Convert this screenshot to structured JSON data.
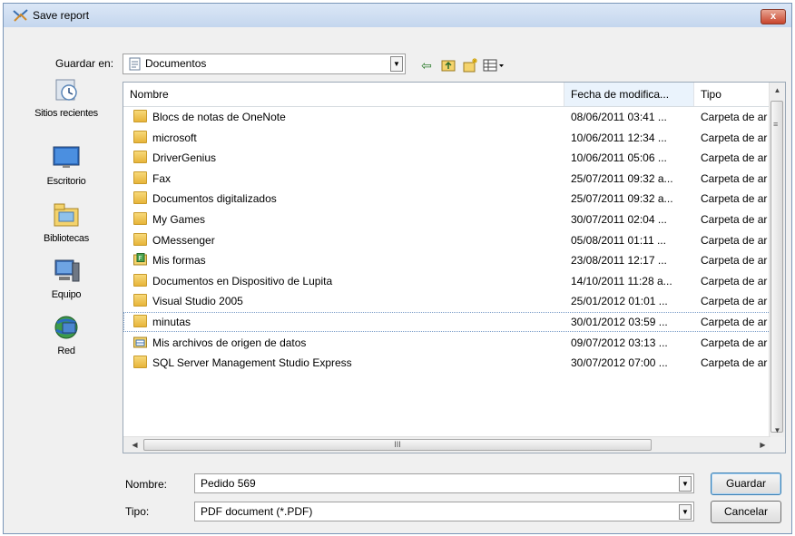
{
  "window": {
    "title": "Save report",
    "close_label": "x"
  },
  "toolbar": {
    "location_label": "Guardar en:",
    "location_value": "Documentos",
    "icons": [
      "back-arrow-icon",
      "up-folder-icon",
      "new-folder-icon",
      "view-menu-icon"
    ]
  },
  "places": [
    {
      "label": "Sitios recientes",
      "icon": "recent-places-icon"
    },
    {
      "label": "Escritorio",
      "icon": "desktop-icon"
    },
    {
      "label": "Bibliotecas",
      "icon": "libraries-icon"
    },
    {
      "label": "Equipo",
      "icon": "computer-icon"
    },
    {
      "label": "Red",
      "icon": "network-icon"
    }
  ],
  "columns": {
    "name": "Nombre",
    "date": "Fecha de modifica...",
    "type": "Tipo"
  },
  "files": [
    {
      "name": "Blocs de notas de OneNote",
      "date": "08/06/2011 03:41 ...",
      "type": "Carpeta de ar",
      "icon": "folder"
    },
    {
      "name": "microsoft",
      "date": "10/06/2011 12:34 ...",
      "type": "Carpeta de ar",
      "icon": "folder"
    },
    {
      "name": "DriverGenius",
      "date": "10/06/2011 05:06 ...",
      "type": "Carpeta de ar",
      "icon": "folder"
    },
    {
      "name": "Fax",
      "date": "25/07/2011 09:32 a...",
      "type": "Carpeta de ar",
      "icon": "folder"
    },
    {
      "name": "Documentos digitalizados",
      "date": "25/07/2011 09:32 a...",
      "type": "Carpeta de ar",
      "icon": "folder"
    },
    {
      "name": "My Games",
      "date": "30/07/2011 02:04 ...",
      "type": "Carpeta de ar",
      "icon": "folder"
    },
    {
      "name": "OMessenger",
      "date": "05/08/2011 01:11 ...",
      "type": "Carpeta de ar",
      "icon": "folder"
    },
    {
      "name": "Mis formas",
      "date": "23/08/2011 12:17 ...",
      "type": "Carpeta de ar",
      "icon": "forms"
    },
    {
      "name": "Documentos en Dispositivo de Lupita",
      "date": "14/10/2011 11:28 a...",
      "type": "Carpeta de ar",
      "icon": "folder"
    },
    {
      "name": "Visual Studio 2005",
      "date": "25/01/2012 01:01 ...",
      "type": "Carpeta de ar",
      "icon": "folder"
    },
    {
      "name": "minutas",
      "date": "30/01/2012 03:59 ...",
      "type": "Carpeta de ar",
      "icon": "folder"
    },
    {
      "name": "Mis archivos de origen de datos",
      "date": "09/07/2012 03:13 ...",
      "type": "Carpeta de ar",
      "icon": "datasource"
    },
    {
      "name": "SQL Server Management Studio Express",
      "date": "30/07/2012 07:00 ...",
      "type": "Carpeta de ar",
      "icon": "folder"
    }
  ],
  "hover_row": 10,
  "scroll": {
    "h_thumb_label": "III",
    "v_marker": "≡"
  },
  "form": {
    "name_label": "Nombre:",
    "name_value": "Pedido 569",
    "type_label": "Tipo:",
    "type_value": "PDF document (*.PDF)"
  },
  "buttons": {
    "save": "Guardar",
    "cancel": "Cancelar"
  },
  "colors": {
    "folder": "#e7b43a",
    "title_bar": "#c4d6ee",
    "close_button": "#c8442c"
  }
}
